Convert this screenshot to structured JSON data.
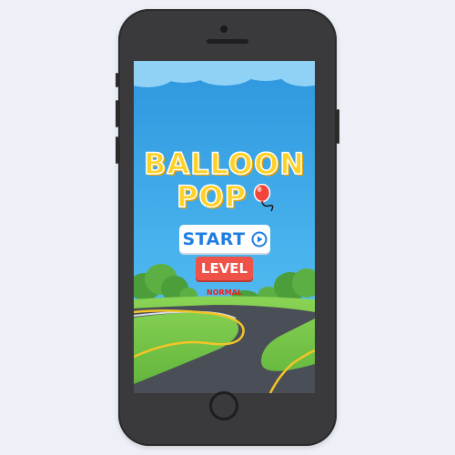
{
  "game": {
    "title_line1": "BALLOON",
    "title_line2": "POP",
    "balloon_icon": "balloon-icon"
  },
  "menu": {
    "start_label": "START",
    "start_icon": "play-circle-icon",
    "level_label": "LEVEL",
    "difficulty": "NORMAL"
  },
  "colors": {
    "sky": "#35a6e8",
    "title": "#ffd126",
    "start_text": "#1f7fe0",
    "level_button": "#ee5248",
    "difficulty_text": "#e8231a",
    "grass": "#7ccb4f",
    "road": "#4a4f57",
    "road_line": "#f4c426",
    "phone_body": "#3a3a3c"
  }
}
